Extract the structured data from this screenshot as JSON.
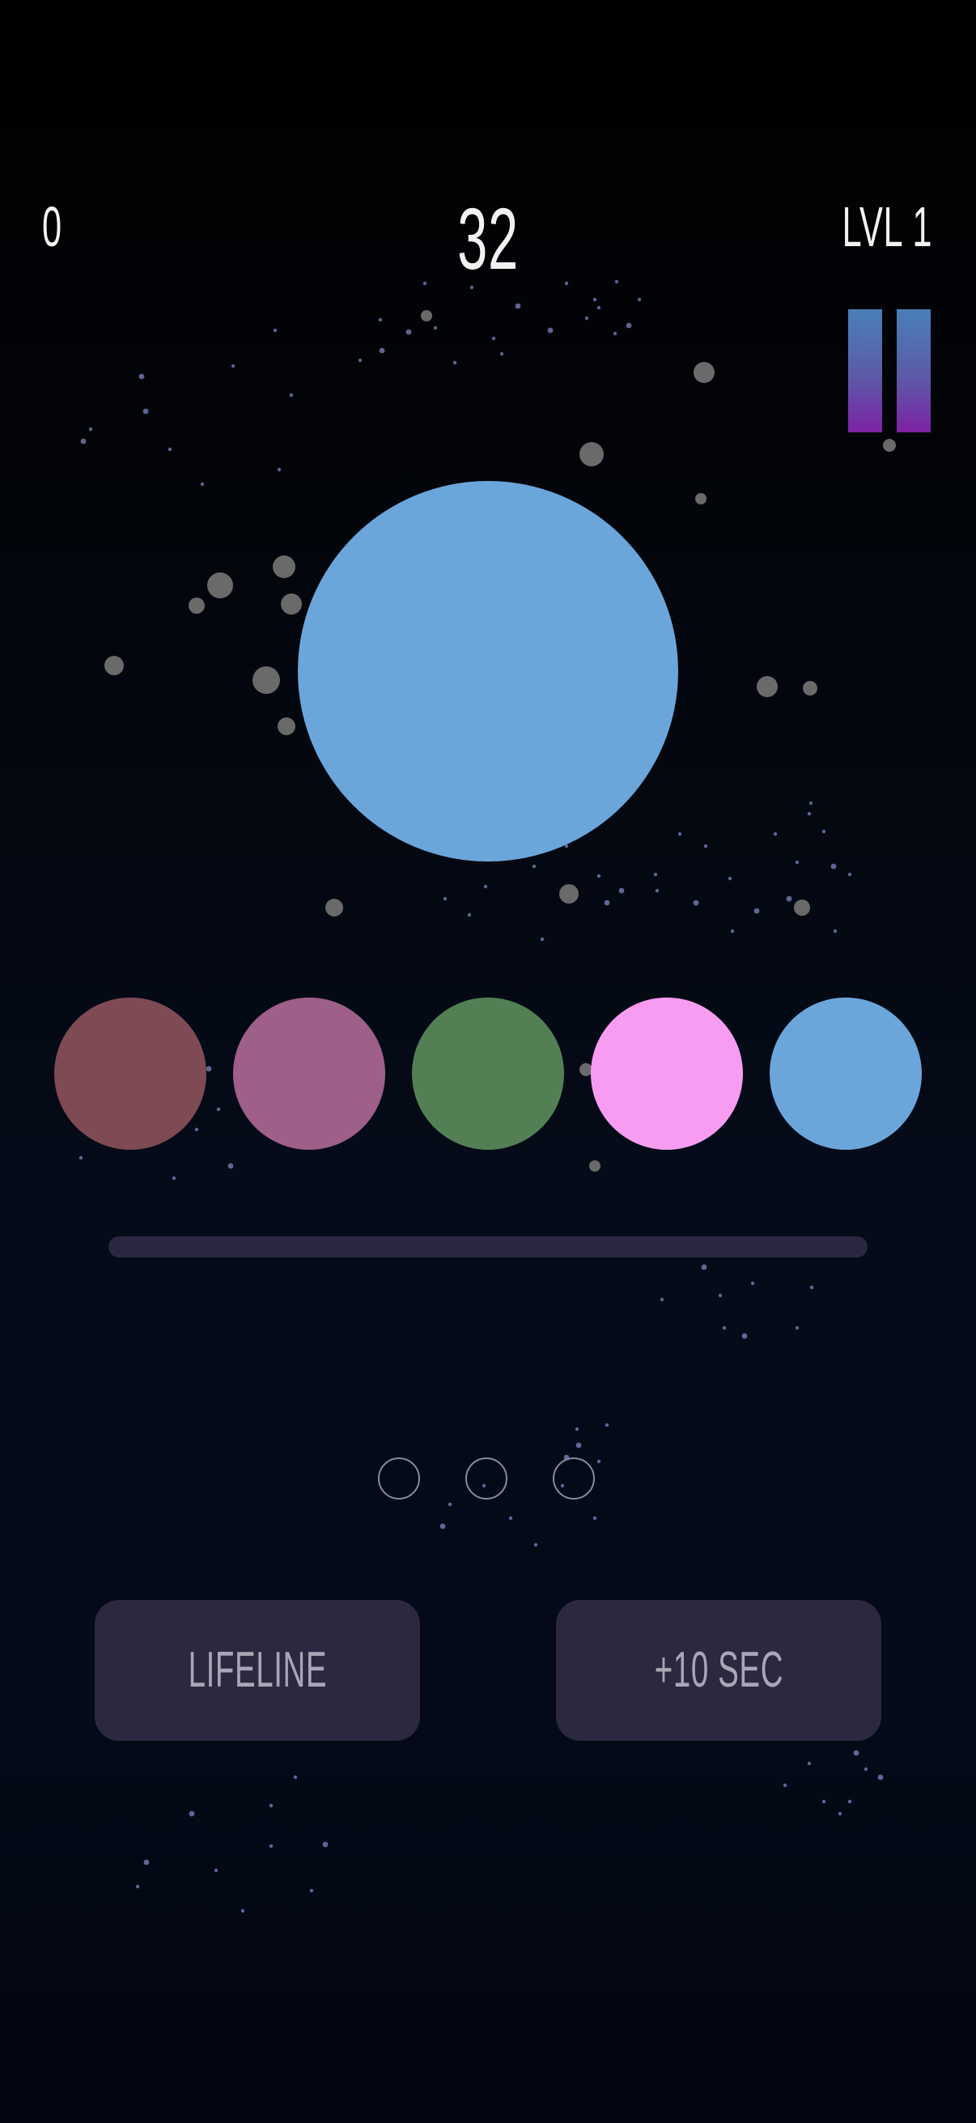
{
  "hud": {
    "score": "0",
    "timer": "32",
    "level": "LVL 1"
  },
  "pause_button": {
    "icon": "pause-icon",
    "color_top": "#4a80b8",
    "color_bottom": "#7d22a4"
  },
  "target_color": "#6ba6db",
  "choices": [
    {
      "name": "choice-maroon",
      "color": "#7e4a54"
    },
    {
      "name": "choice-mauve",
      "color": "#9e5f89"
    },
    {
      "name": "choice-green",
      "color": "#537f55"
    },
    {
      "name": "choice-pink",
      "color": "#f89cf2"
    },
    {
      "name": "choice-blue",
      "color": "#6ba6db"
    }
  ],
  "lives": {
    "count": 3,
    "used": 0
  },
  "buttons": {
    "lifeline": "LIFELINE",
    "add_time": "+10 SEC"
  },
  "colors": {
    "background": "#020611",
    "track": "#2b2740",
    "button_bg": "#2c2840",
    "button_text": "#a9a6b6"
  }
}
